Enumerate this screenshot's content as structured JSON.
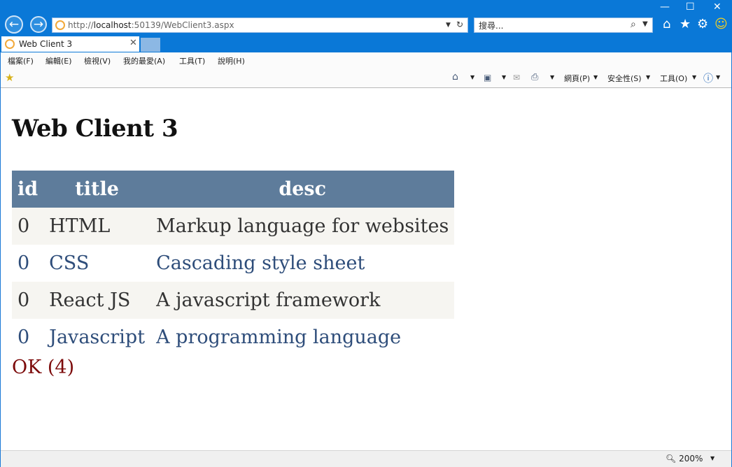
{
  "browser": {
    "url_prefix": "http://",
    "url_host": "localhost",
    "url_rest": ":50139/WebClient3.aspx",
    "search_placeholder": "搜尋...",
    "tab_title": "Web Client 3",
    "menu": [
      "檔案(F)",
      "編輯(E)",
      "檢視(V)",
      "我的最愛(A)",
      "工具(T)",
      "說明(H)"
    ],
    "command": {
      "page": "網頁(P)",
      "safety": "安全性(S)",
      "tools": "工具(O)"
    },
    "zoom": "200%"
  },
  "page": {
    "heading": "Web Client 3",
    "columns": [
      "id",
      "title",
      "desc"
    ],
    "rows": [
      {
        "id": "0",
        "title": "HTML",
        "desc": "Markup language for websites"
      },
      {
        "id": "0",
        "title": "CSS",
        "desc": "Cascading style sheet"
      },
      {
        "id": "0",
        "title": "React JS",
        "desc": "A javascript framework"
      },
      {
        "id": "0",
        "title": "Javascript",
        "desc": "A programming language"
      }
    ],
    "status": "OK (4)"
  },
  "colors": {
    "chrome": "#0a78d7",
    "header": "#5e7c9b",
    "row_alt": "#f6f5f1",
    "link": "#2e4d7a",
    "status": "#7c0a0a"
  }
}
